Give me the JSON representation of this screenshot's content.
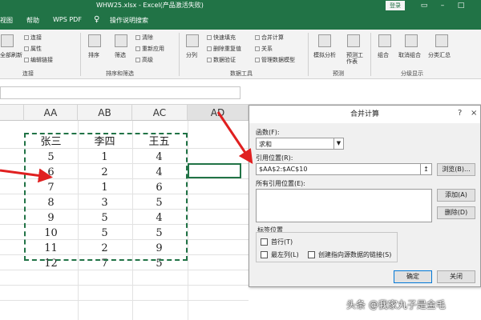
{
  "window": {
    "title": "WHW25.xlsx - Excel(产品激活失败)",
    "login_label": "登录"
  },
  "menu": {
    "tabs": [
      "视图",
      "帮助",
      "WPS PDF",
      "操作说明搜索"
    ]
  },
  "ribbon": {
    "connections": {
      "items": [
        "连接",
        "属性",
        "编辑链接"
      ],
      "group_label": "连接",
      "refresh_label": "全部刷新"
    },
    "sort_filter": {
      "sort_label": "排序",
      "filter_label": "筛选",
      "items": [
        "清除",
        "重新应用",
        "高级"
      ],
      "group_label": "排序和筛选"
    },
    "data_tools": {
      "split_label": "分列",
      "items": [
        "快速填充",
        "删除重复值",
        "数据验证",
        "合并计算",
        "关系",
        "管理数据模型"
      ],
      "group_label": "数据工具"
    },
    "forecast": {
      "items": [
        "模拟分析",
        "预测工作表"
      ],
      "group_label": "预测"
    },
    "outline": {
      "items": [
        "组合",
        "取消组合",
        "分类汇总"
      ],
      "group_label": "分级显示"
    }
  },
  "sheet": {
    "columns": [
      "AA",
      "AB",
      "AC",
      "AD"
    ],
    "header_row": [
      "张三",
      "李四",
      "王五"
    ],
    "rows": [
      [
        "5",
        "1",
        "4"
      ],
      [
        "6",
        "2",
        "4"
      ],
      [
        "7",
        "1",
        "6"
      ],
      [
        "8",
        "3",
        "5"
      ],
      [
        "9",
        "5",
        "4"
      ],
      [
        "10",
        "5",
        "5"
      ],
      [
        "11",
        "2",
        "9"
      ],
      [
        "12",
        "7",
        "5"
      ]
    ]
  },
  "dialog": {
    "title": "合并计算",
    "help_icon": "?",
    "close_icon": "×",
    "function_label": "函数(F):",
    "function_value": "求和",
    "reference_label": "引用位置(R):",
    "reference_value": "$AA$2:$AC$10",
    "browse_label": "浏览(B)...",
    "all_references_label": "所有引用位置(E):",
    "add_label": "添加(A)",
    "delete_label": "删除(D)",
    "label_position_legend": "标签位置",
    "top_row_label": "首行(T)",
    "left_column_label": "最左列(L)",
    "link_source_label": "创建指向源数据的链接(S)",
    "ok_label": "确定",
    "close_label": "关闭"
  },
  "watermark": "头条 @我家丸子是金毛",
  "colors": {
    "excel_green": "#217346",
    "arrow_red": "#e02020"
  }
}
